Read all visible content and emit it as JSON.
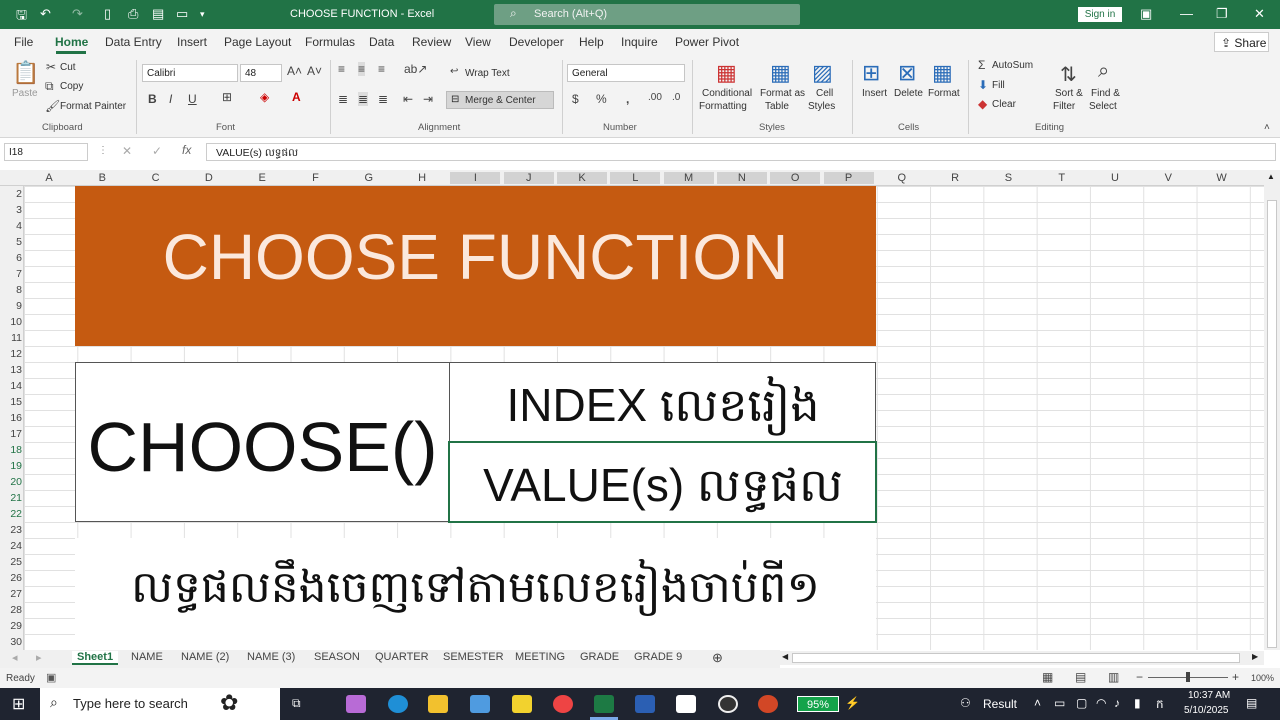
{
  "app": {
    "title": "CHOOSE FUNCTION  -  Excel",
    "search_placeholder": "Search (Alt+Q)",
    "signin": "Sign in"
  },
  "menu": {
    "items": [
      "File",
      "Home",
      "Data Entry",
      "Insert",
      "Page Layout",
      "Formulas",
      "Data",
      "Review",
      "View",
      "Developer",
      "Help",
      "Inquire",
      "Power Pivot"
    ],
    "share": "Share"
  },
  "ribbon": {
    "clipboard": {
      "paste": "Paste",
      "cut": "Cut",
      "copy": "Copy",
      "format_painter": "Format Painter",
      "label": "Clipboard"
    },
    "font": {
      "name": "Calibri",
      "size": "48",
      "label": "Font"
    },
    "alignment": {
      "wrap_text": "Wrap Text",
      "merge_center": "Merge & Center",
      "label": "Alignment"
    },
    "number": {
      "format": "General",
      "label": "Number"
    },
    "styles": {
      "conditional": "Conditional",
      "formatting": "Formatting",
      "format_as": "Format as",
      "table": "Table",
      "cell": "Cell",
      "styles_btn": "Styles",
      "label": "Styles"
    },
    "cells": {
      "insert": "Insert",
      "delete": "Delete",
      "format": "Format",
      "label": "Cells"
    },
    "editing": {
      "autosum": "AutoSum",
      "fill": "Fill",
      "clear": "Clear",
      "sort": "Sort &",
      "filter": "Filter",
      "find": "Find &",
      "select": "Select",
      "label": "Editing"
    }
  },
  "formula_bar": {
    "name_box": "I18",
    "formula": "VALUE(s) លទ្ធផល"
  },
  "grid": {
    "columns": [
      "A",
      "B",
      "C",
      "D",
      "E",
      "F",
      "G",
      "H",
      "I",
      "J",
      "K",
      "L",
      "M",
      "N",
      "O",
      "P",
      "Q",
      "R",
      "S",
      "T",
      "U",
      "V",
      "W"
    ],
    "rows": [
      "2",
      "3",
      "4",
      "5",
      "6",
      "7",
      "8",
      "9",
      "10",
      "11",
      "12",
      "13",
      "14",
      "15",
      "16",
      "17",
      "18",
      "19",
      "20",
      "21",
      "22",
      "23",
      "24",
      "25",
      "26",
      "27",
      "28",
      "29",
      "30"
    ],
    "banner_title": "CHOOSE FUNCTION",
    "choose_label": "CHOOSE()",
    "index_label": "INDEX លេខរៀង",
    "value_label": "VALUE(s) លទ្ធផល",
    "bottom_text": "លទ្ធផលនឹងចេញទៅតាមលេខរៀងចាប់ពី១",
    "banner_color": "#c55a11"
  },
  "sheets": {
    "tabs": [
      "Sheet1",
      "NAME",
      "NAME (2)",
      "NAME (3)",
      "SEASON",
      "QUARTER",
      "SEMESTER",
      "MEETING",
      "GRADE",
      "GRADE 9"
    ],
    "active": "Sheet1"
  },
  "status": {
    "ready": "Ready",
    "zoom": "100%"
  },
  "taskbar": {
    "search_placeholder": "Type here to search",
    "battery": "95%",
    "result_label": "Result",
    "time": "10:37 AM",
    "date": "5/10/2025"
  }
}
